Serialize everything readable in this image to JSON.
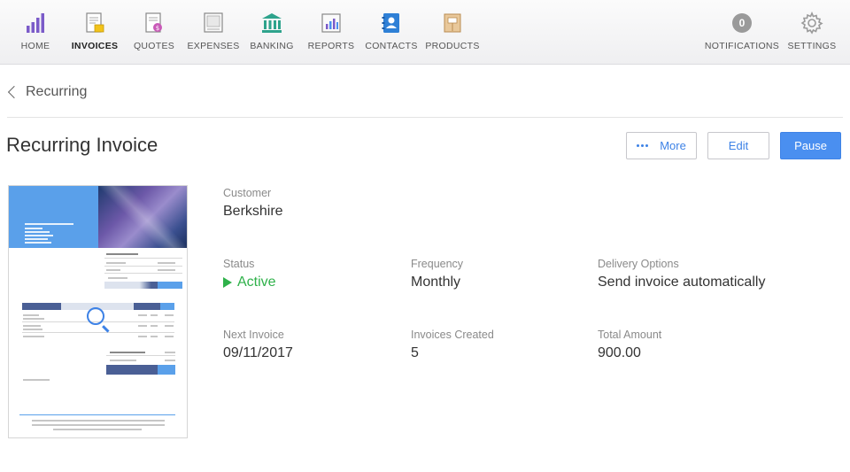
{
  "nav": {
    "items": [
      {
        "label": "HOME",
        "icon": "bar-chart-icon"
      },
      {
        "label": "INVOICES",
        "icon": "invoice-document-icon",
        "active": true
      },
      {
        "label": "QUOTES",
        "icon": "quote-document-icon"
      },
      {
        "label": "EXPENSES",
        "icon": "expenses-icon"
      },
      {
        "label": "BANKING",
        "icon": "bank-icon"
      },
      {
        "label": "REPORTS",
        "icon": "report-chart-icon"
      },
      {
        "label": "CONTACTS",
        "icon": "address-book-icon"
      },
      {
        "label": "PRODUCTS",
        "icon": "product-box-icon"
      }
    ],
    "notifications_count": "0",
    "notifications_label": "NOTIFICATIONS",
    "settings_label": "SETTINGS"
  },
  "breadcrumb": {
    "label": "Recurring"
  },
  "page": {
    "title": "Recurring Invoice"
  },
  "actions": {
    "more": "More",
    "edit": "Edit",
    "pause": "Pause"
  },
  "details": {
    "customer": {
      "label": "Customer",
      "value": "Berkshire"
    },
    "status": {
      "label": "Status",
      "value": "Active"
    },
    "frequency": {
      "label": "Frequency",
      "value": "Monthly"
    },
    "delivery": {
      "label": "Delivery Options",
      "value": "Send invoice automatically"
    },
    "next_invoice": {
      "label": "Next Invoice",
      "value": "09/11/2017"
    },
    "invoices_created": {
      "label": "Invoices Created",
      "value": "5"
    },
    "total_amount": {
      "label": "Total Amount",
      "value": "900.00"
    }
  },
  "colors": {
    "accent": "#4a8ff0",
    "status_active": "#2fb14a"
  }
}
